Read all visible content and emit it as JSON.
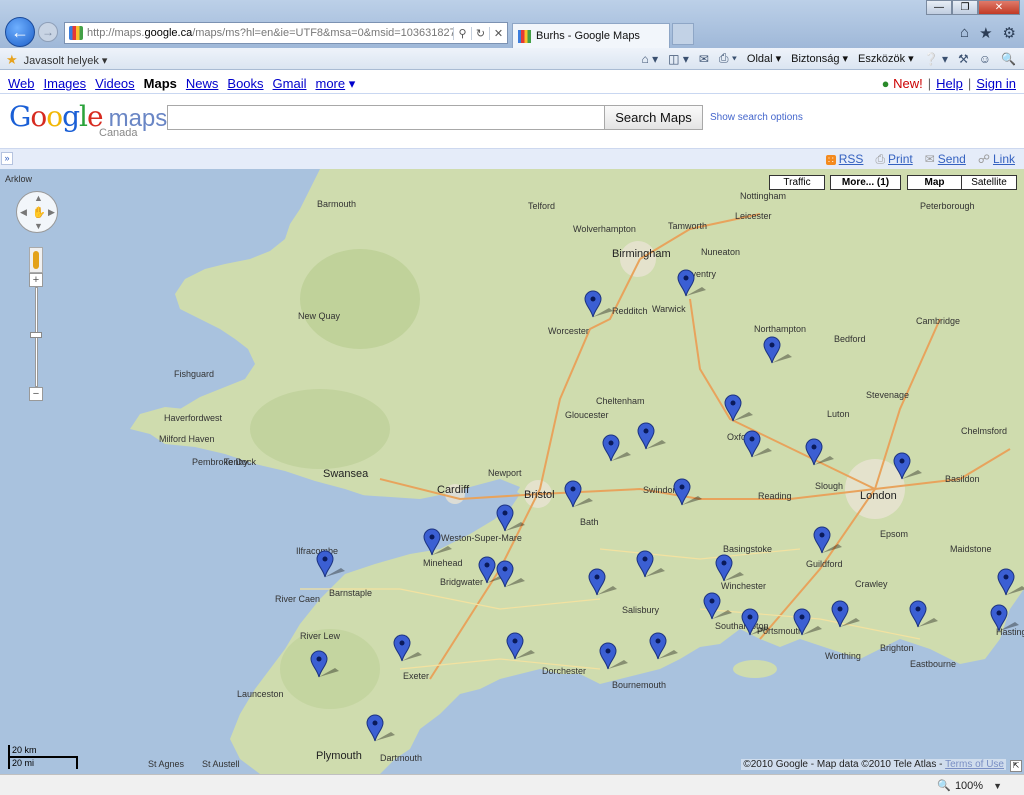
{
  "browser": {
    "url_prefix": "http://maps.",
    "url_domain": "google.ca",
    "url_rest": "/maps/ms?hl=en&ie=UTF8&msa=0&msid=1036318278397",
    "tab_title": "Burhs - Google Maps",
    "favorites_label": "Javasolt helyek",
    "menu": [
      "Oldal",
      "Biztonság",
      "Eszközök"
    ],
    "zoom": "100%"
  },
  "gbar": {
    "links": [
      "Web",
      "Images",
      "Videos",
      "Maps",
      "News",
      "Books",
      "Gmail",
      "more"
    ],
    "current": "Maps",
    "new_label": "New!",
    "help": "Help",
    "sign_in": "Sign in"
  },
  "header": {
    "logo_sub": "Canada",
    "search_placeholder": "",
    "search_button": "Search Maps",
    "search_options": "Show search options"
  },
  "toolbar": {
    "rss": "RSS",
    "print": "Print",
    "send": "Send",
    "link": "Link"
  },
  "map": {
    "buttons": {
      "traffic": "Traffic",
      "more": "More... (1)",
      "map": "Map",
      "satellite": "Satellite"
    },
    "scale_km": "20 km",
    "scale_mi": "20 mi",
    "copyright": "©2010 Google - Map data ©2010 Tele Atlas -",
    "terms": "Terms of Use",
    "marker_color": "#3b5fd3",
    "land_color": "#cfdcae",
    "sea_color": "#a9c2de"
  }
}
